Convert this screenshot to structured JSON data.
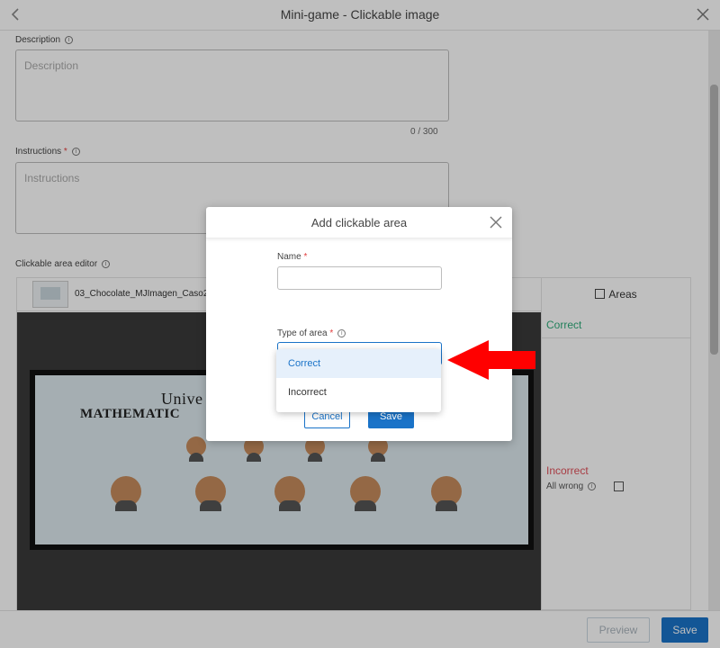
{
  "header": {
    "title": "Mini-game - Clickable image"
  },
  "form": {
    "description_label": "Description",
    "description_placeholder": "Description",
    "description_counter": "0 / 300",
    "instructions_label": "Instructions",
    "instructions_required": "*",
    "instructions_placeholder": "Instructions",
    "editor_label": "Clickable area editor"
  },
  "editor": {
    "file_name": "03_Chocolate_MJImagen_Caso2",
    "image_title_line1": "Unive",
    "image_title_line2": "MATHEMATIC",
    "areas_title": "Areas",
    "correct_label": "Correct",
    "incorrect_label": "Incorrect",
    "all_wrong_label": "All wrong"
  },
  "modal": {
    "title": "Add clickable area",
    "name_label": "Name",
    "required_mark": "*",
    "name_value": "",
    "type_label": "Type of area",
    "cancel_label": "Cancel",
    "save_label": "Save"
  },
  "dropdown": {
    "options": [
      "Correct",
      "Incorrect"
    ],
    "selected": "Correct"
  },
  "footer": {
    "preview_label": "Preview",
    "save_label": "Save"
  },
  "colors": {
    "primary": "#1a73c8",
    "correct": "#2eab7a",
    "incorrect": "#e0505a",
    "arrow": "#ff0000"
  },
  "icons": [
    "back-arrow-icon",
    "close-icon",
    "info-icon",
    "area-square-icon",
    "red-arrow-icon"
  ]
}
